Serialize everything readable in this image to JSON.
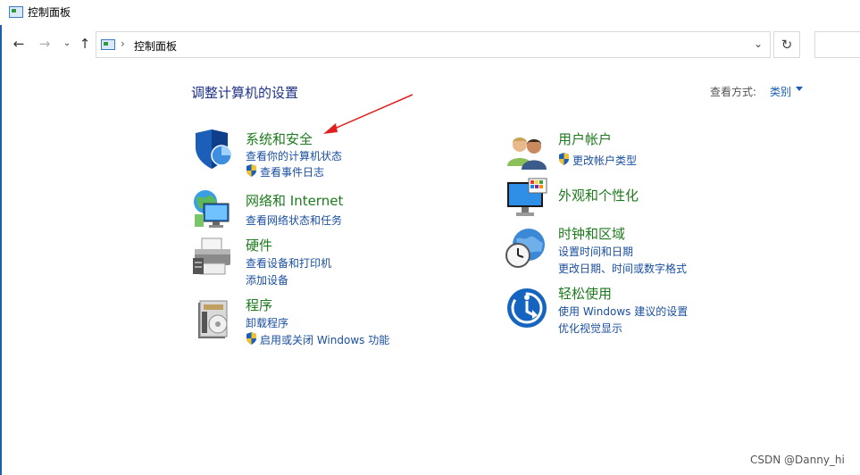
{
  "window": {
    "title": "控制面板"
  },
  "address": {
    "path": "控制面板",
    "separator": "›"
  },
  "header": {
    "title": "调整计算机的设置",
    "view_by_label": "查看方式:",
    "view_by_value": "类别"
  },
  "categories": {
    "system": {
      "title": "系统和安全",
      "links": [
        "查看你的计算机状态",
        "查看事件日志"
      ]
    },
    "network": {
      "title": "网络和 Internet",
      "links": [
        "查看网络状态和任务"
      ]
    },
    "hardware": {
      "title": "硬件",
      "links": [
        "查看设备和打印机",
        "添加设备"
      ]
    },
    "programs": {
      "title": "程序",
      "links": [
        "卸载程序",
        "启用或关闭 Windows 功能"
      ]
    },
    "user": {
      "title": "用户帐户",
      "links": [
        "更改帐户类型"
      ]
    },
    "appearance": {
      "title": "外观和个性化",
      "links": []
    },
    "clock": {
      "title": "时钟和区域",
      "links": [
        "设置时间和日期",
        "更改日期、时间或数字格式"
      ]
    },
    "ease": {
      "title": "轻松使用",
      "links": [
        "使用 Windows 建议的设置",
        "优化视觉显示"
      ]
    }
  },
  "watermark": "CSDN @Danny_hi",
  "colors": {
    "category_title": "#1e7a1e",
    "link": "#1a4fa0",
    "page_title": "#1e3287",
    "annotation_arrow": "#e02020"
  }
}
